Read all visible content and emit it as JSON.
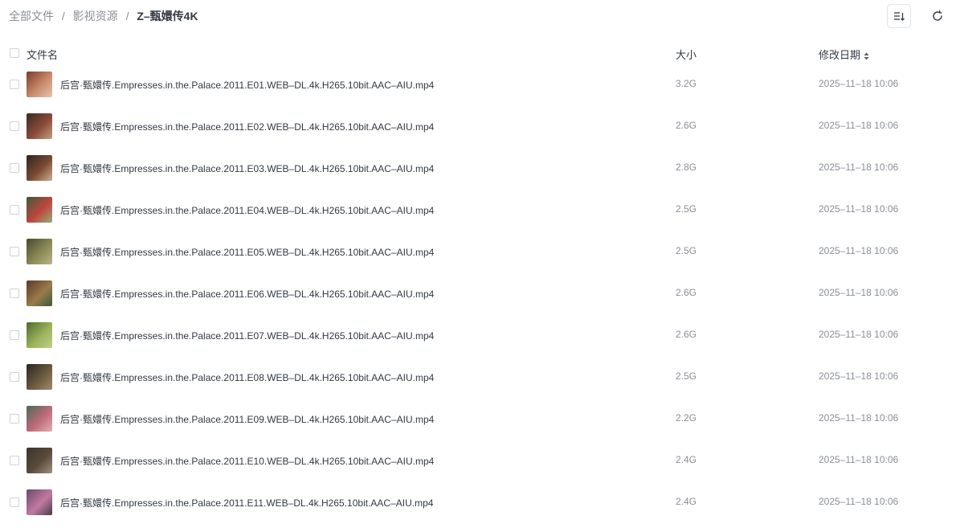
{
  "breadcrumb": {
    "items": [
      "全部文件",
      "影视资源"
    ],
    "separator": "/",
    "current": "Z–甄嬛传4K"
  },
  "toolbar": {
    "sort_icon": "sort-list-icon",
    "refresh_icon": "refresh-icon"
  },
  "table": {
    "headers": {
      "name": "文件名",
      "size": "大小",
      "date": "修改日期"
    },
    "rows": [
      {
        "name": "后宫·甄嬛传.Empresses.in.the.Palace.2011.E01.WEB–DL.4k.H265.10bit.AAC–AIU.mp4",
        "size": "3.2G",
        "date": "2025–11–18 10:06"
      },
      {
        "name": "后宫·甄嬛传.Empresses.in.the.Palace.2011.E02.WEB–DL.4k.H265.10bit.AAC–AIU.mp4",
        "size": "2.6G",
        "date": "2025–11–18 10:06"
      },
      {
        "name": "后宫·甄嬛传.Empresses.in.the.Palace.2011.E03.WEB–DL.4k.H265.10bit.AAC–AIU.mp4",
        "size": "2.8G",
        "date": "2025–11–18 10:06"
      },
      {
        "name": "后宫·甄嬛传.Empresses.in.the.Palace.2011.E04.WEB–DL.4k.H265.10bit.AAC–AIU.mp4",
        "size": "2.5G",
        "date": "2025–11–18 10:06"
      },
      {
        "name": "后宫·甄嬛传.Empresses.in.the.Palace.2011.E05.WEB–DL.4k.H265.10bit.AAC–AIU.mp4",
        "size": "2.5G",
        "date": "2025–11–18 10:06"
      },
      {
        "name": "后宫·甄嬛传.Empresses.in.the.Palace.2011.E06.WEB–DL.4k.H265.10bit.AAC–AIU.mp4",
        "size": "2.6G",
        "date": "2025–11–18 10:06"
      },
      {
        "name": "后宫·甄嬛传.Empresses.in.the.Palace.2011.E07.WEB–DL.4k.H265.10bit.AAC–AIU.mp4",
        "size": "2.6G",
        "date": "2025–11–18 10:06"
      },
      {
        "name": "后宫·甄嬛传.Empresses.in.the.Palace.2011.E08.WEB–DL.4k.H265.10bit.AAC–AIU.mp4",
        "size": "2.5G",
        "date": "2025–11–18 10:06"
      },
      {
        "name": "后宫·甄嬛传.Empresses.in.the.Palace.2011.E09.WEB–DL.4k.H265.10bit.AAC–AIU.mp4",
        "size": "2.2G",
        "date": "2025–11–18 10:06"
      },
      {
        "name": "后宫·甄嬛传.Empresses.in.the.Palace.2011.E10.WEB–DL.4k.H265.10bit.AAC–AIU.mp4",
        "size": "2.4G",
        "date": "2025–11–18 10:06"
      },
      {
        "name": "后宫·甄嬛传.Empresses.in.the.Palace.2011.E11.WEB–DL.4k.H265.10bit.AAC–AIU.mp4",
        "size": "2.4G",
        "date": "2025–11–18 10:06"
      }
    ]
  },
  "colors": {
    "text_primary": "#333a45",
    "text_secondary": "#8a8f99",
    "checkbox_border": "#cfd3d9",
    "button_border": "#e2e4e8"
  }
}
